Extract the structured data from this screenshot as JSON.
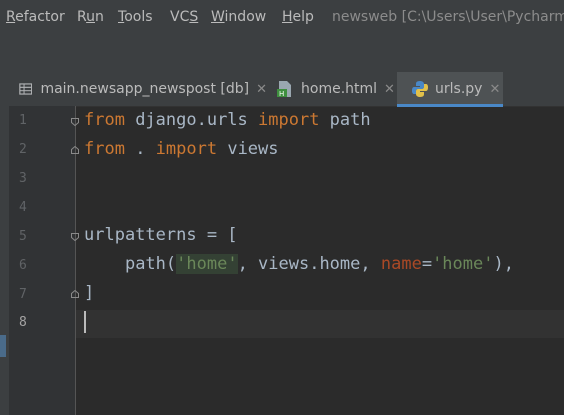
{
  "menu": {
    "items": [
      "Refactor",
      "Run",
      "Tools",
      "VCS",
      "Window",
      "Help"
    ],
    "window_title": "newsweb [C:\\Users\\User\\PycharmPr"
  },
  "tabs": [
    {
      "label": "main.newsapp_newspost [db]",
      "icon": "database-table-icon",
      "active": false
    },
    {
      "label": "home.html",
      "icon": "html-file-icon",
      "active": false
    },
    {
      "label": "urls.py",
      "icon": "python-file-icon",
      "active": true
    }
  ],
  "editor": {
    "line_numbers": [
      "1",
      "2",
      "3",
      "4",
      "5",
      "6",
      "7",
      "8"
    ],
    "current_line": "8",
    "code": {
      "l1": {
        "kw1": "from",
        "mod": " django.urls ",
        "kw2": "import",
        "name": " path"
      },
      "l2": {
        "kw1": "from",
        "mod": " . ",
        "kw2": "import",
        "name": " views"
      },
      "l5": {
        "text": "urlpatterns = ["
      },
      "l6": {
        "indent": "    ",
        "fn": "path(",
        "s1": "'home'",
        "mid": ", views.home, ",
        "kwarg": "name",
        "eq": "=",
        "s2": "'home'",
        "end": "),"
      },
      "l7": {
        "text": "]"
      }
    }
  },
  "colors": {
    "background": "#2b2b2b",
    "keyword": "#cc7832",
    "string": "#6a8759",
    "named_arg": "#aa4926",
    "text": "#a9b7c6",
    "active_tab_underline": "#4a88c7"
  }
}
